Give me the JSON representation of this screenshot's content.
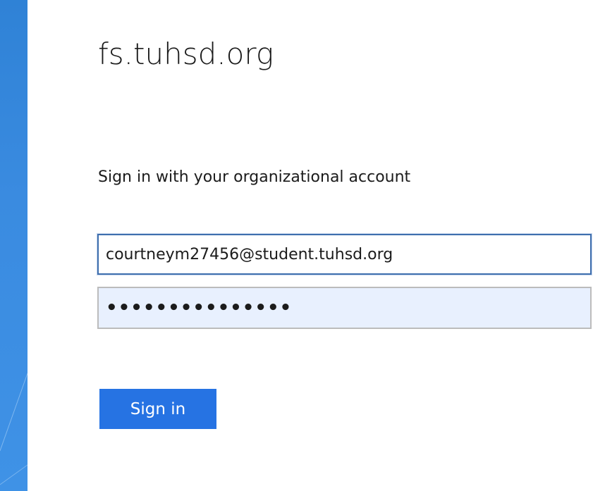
{
  "header": {
    "site_title": "fs.tuhsd.org"
  },
  "form": {
    "prompt": "Sign in with your organizational account",
    "email_value": "courtneym27456@student.tuhsd.org",
    "password_value": "•••••••••••••••",
    "signin_label": "Sign in"
  },
  "theme": {
    "accent": "#2673e3",
    "side_panel": "#3a8be0",
    "password_field_bg": "#e8f0fe"
  }
}
